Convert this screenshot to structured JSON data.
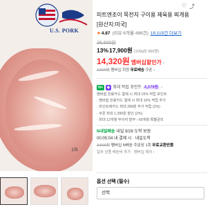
{
  "gallery": {
    "logo_text": "U.S. PORK",
    "counter": "1/6",
    "thumbs": [
      "thumb-1",
      "thumb-2",
      "thumb-3"
    ]
  },
  "header": {
    "heart_icon": "heart-icon",
    "share_icon": "share-icon"
  },
  "product": {
    "title_line1": "미트엔조이 목전지 구이용 제육용 찌개용",
    "title_line2": "[원산지:미국]",
    "rating_score": "4.87",
    "rating_meta": "(리뷰 6개월 486건)",
    "rating_link": "18,119건 더보기",
    "original_price": "26,600원",
    "discount": "13%",
    "sale_price": "17,900원",
    "unit_price": "(100g당 895원)",
    "member_price": "14,320원",
    "member_label": "멤버십할인가",
    "member_link": "› ",
    "coupon_old": "3,500원",
    "coupon_text": " 멤버십 회원 ",
    "coupon_new": "무료배송",
    "coupon_tail": " 쿠폰 ›"
  },
  "points": {
    "badge": "N+",
    "membership_label": "최대 적립 포인트",
    "value": "4,079원",
    "chevron": "›"
  },
  "benefits": [
    "멤버쉽 전용카드 결제 시 최대 15% 적립 포인트",
    "· 멤버쉽 전용카드 결제 시 최대 10% 적립 추가",
    "· 라인트레카드 최대 288원 추가 적립 (2%)",
    "· 쿠폰 최대 1,399원 할인 (2%)",
    "· 최대 12개월 무이자 할부 › 60개월 특별금리"
  ],
  "delivery": {
    "tag": "N내일배송",
    "when": "내일 9/26 도착 보장",
    "sub_prefix": "00:05:04 내 결제 시",
    "sub_sep": " · ",
    "sub_suffix": "내일도착",
    "fee_old": "3,500원",
    "fee_middle": " 멤버십 N배송 주문당 1회 ",
    "fee_new": "무료교환반품",
    "note": "일부 상품 배송비 추가 · 멤버십 제외 ›"
  },
  "options": {
    "title": "옵션 선택 (필수)",
    "select_value": "선택"
  }
}
